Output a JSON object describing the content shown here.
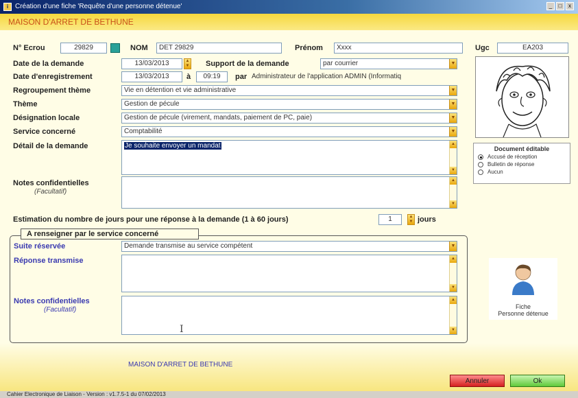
{
  "window": {
    "title": "Création d'une fiche 'Requête d'une personne détenue'",
    "controls": {
      "minimize": "_",
      "maximize": "□",
      "close": "x"
    }
  },
  "header": {
    "prison_name": "MAISON D'ARRET DE BETHUNE"
  },
  "detainee": {
    "ecrou_label": "N° Ecrou",
    "ecrou_value": "29829",
    "nom_label": "NOM",
    "nom_value": "DET 29829",
    "prenom_label": "Prénom",
    "prenom_value": "Xxxx",
    "ugc_label": "Ugc",
    "ugc_value": "EA203"
  },
  "request": {
    "date_demande_label": "Date de la demande",
    "date_demande_value": "13/03/2013",
    "support_label": "Support de la demande",
    "support_value": "par courrier",
    "date_enreg_label": "Date d'enregistrement",
    "date_enreg_value": "13/03/2013",
    "a_label": "à",
    "time_value": "09:19",
    "par_label": "par",
    "par_value": "Administrateur de l'application ADMIN (Informatiq",
    "regroupement_label": "Regroupement thème",
    "regroupement_value": "Vie en détention et vie administrative",
    "theme_label": "Thème",
    "theme_value": "Gestion de pécule",
    "designation_label": "Désignation locale",
    "designation_value": "Gestion de pécule (virement, mandats, paiement de PC, paie)",
    "service_label": "Service concerné",
    "service_value": "Comptabilité",
    "detail_label": "Détail de la demande",
    "detail_value": "Je souhaite envoyer un mandat",
    "notes_label": "Notes confidentielles",
    "notes_sub": "(Facultatif)",
    "notes_value": "",
    "estimation_label": "Estimation du nombre de jours pour une réponse à la demande (1 à 60 jours)",
    "estimation_value": "1",
    "jours_label": "jours"
  },
  "document_editable": {
    "title": "Document éditable",
    "options": [
      "Accusé de réception",
      "Bulletin de réponse",
      "Aucun"
    ],
    "selected": "Accusé de réception"
  },
  "service_section": {
    "title": "A renseigner par le service concerné",
    "suite_label": "Suite réservée",
    "suite_value": "Demande transmise au service compétent",
    "reponse_label": "Réponse transmise",
    "reponse_value": "",
    "notes_label": "Notes confidentielles",
    "notes_sub": "(Facultatif)",
    "notes_value": ""
  },
  "fiche_button": {
    "line1": "Fiche",
    "line2": "Personne détenue"
  },
  "footer": {
    "org": "MAISON D'ARRET DE BETHUNE",
    "cancel": "Annuler",
    "ok": "Ok"
  },
  "statusbar": {
    "text": "Cahier Electronique de Liaison - Version : v1.7.5-1 du 07/02/2013"
  },
  "colors": {
    "accent": "#f6d83e",
    "label_blue": "#3a3ab0",
    "header_text": "#c8501a"
  }
}
